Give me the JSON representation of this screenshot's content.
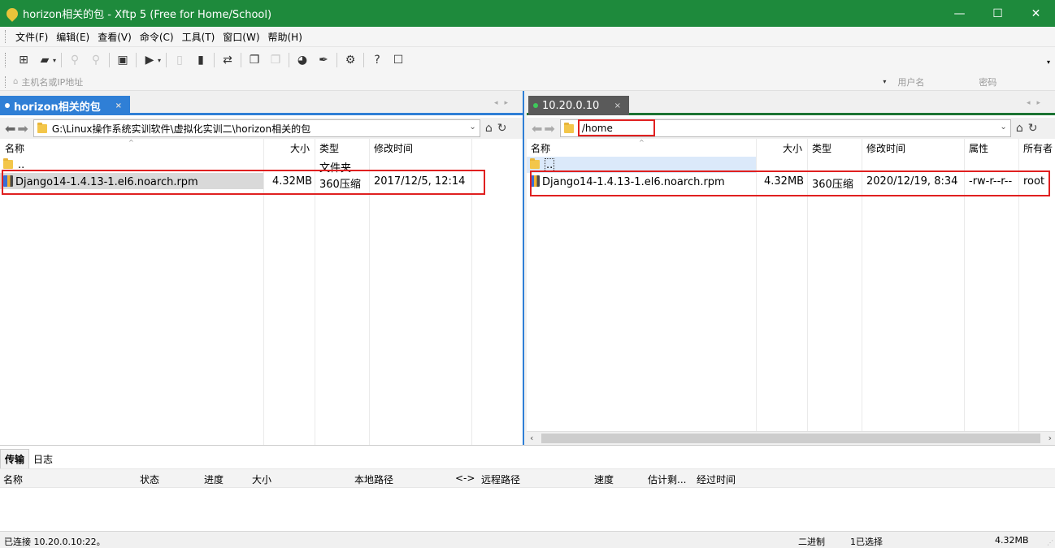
{
  "window": {
    "title": "horizon相关的包 - Xftp 5 (Free for Home/School)",
    "minimize": "—",
    "maximize": "☐",
    "close": "✕"
  },
  "menu": [
    "文件(F)",
    "编辑(E)",
    "查看(V)",
    "命令(C)",
    "工具(T)",
    "窗口(W)",
    "帮助(H)"
  ],
  "address": {
    "host_placeholder": "主机名或IP地址",
    "user_placeholder": "用户名",
    "password_placeholder": "密码"
  },
  "left_pane": {
    "tab_label": "horizon相关的包",
    "tab_close": "×",
    "path": "G:\\Linux操作系统实训软件\\虚拟化实训二\\horizon相关的包",
    "columns": [
      "名称",
      "大小",
      "类型",
      "修改时间"
    ],
    "rows": [
      {
        "name": "..",
        "size": "",
        "type": "文件夹",
        "modified": ""
      },
      {
        "name": "Django14-1.4.13-1.el6.noarch.rpm",
        "size": "4.32MB",
        "type": "360压缩",
        "modified": "2017/12/5, 12:14"
      }
    ]
  },
  "right_pane": {
    "tab_label": "10.20.0.10",
    "tab_close": "×",
    "path": "/home",
    "columns": [
      "名称",
      "大小",
      "类型",
      "修改时间",
      "属性",
      "所有者"
    ],
    "rows": [
      {
        "name": "..",
        "size": "",
        "type": "",
        "modified": "",
        "attr": "",
        "owner": ""
      },
      {
        "name": "Django14-1.4.13-1.el6.noarch.rpm",
        "size": "4.32MB",
        "type": "360压缩",
        "modified": "2020/12/19, 8:34",
        "attr": "-rw-r--r--",
        "owner": "root"
      }
    ]
  },
  "transfer": {
    "tabs": [
      "传输",
      "日志"
    ],
    "columns": [
      "名称",
      "状态",
      "进度",
      "大小",
      "本地路径",
      "<->",
      "远程路径",
      "速度",
      "估计剩...",
      "经过时间"
    ]
  },
  "status": {
    "connection": "已连接 10.20.0.10:22。",
    "mode": "二进制",
    "selected": "1已选择",
    "size": "4.32MB"
  },
  "colors": {
    "titlebar": "#1e8a3c",
    "left_accent": "#2f7fd6",
    "right_accent": "#1b7332",
    "highlight_box": "#e02020"
  }
}
